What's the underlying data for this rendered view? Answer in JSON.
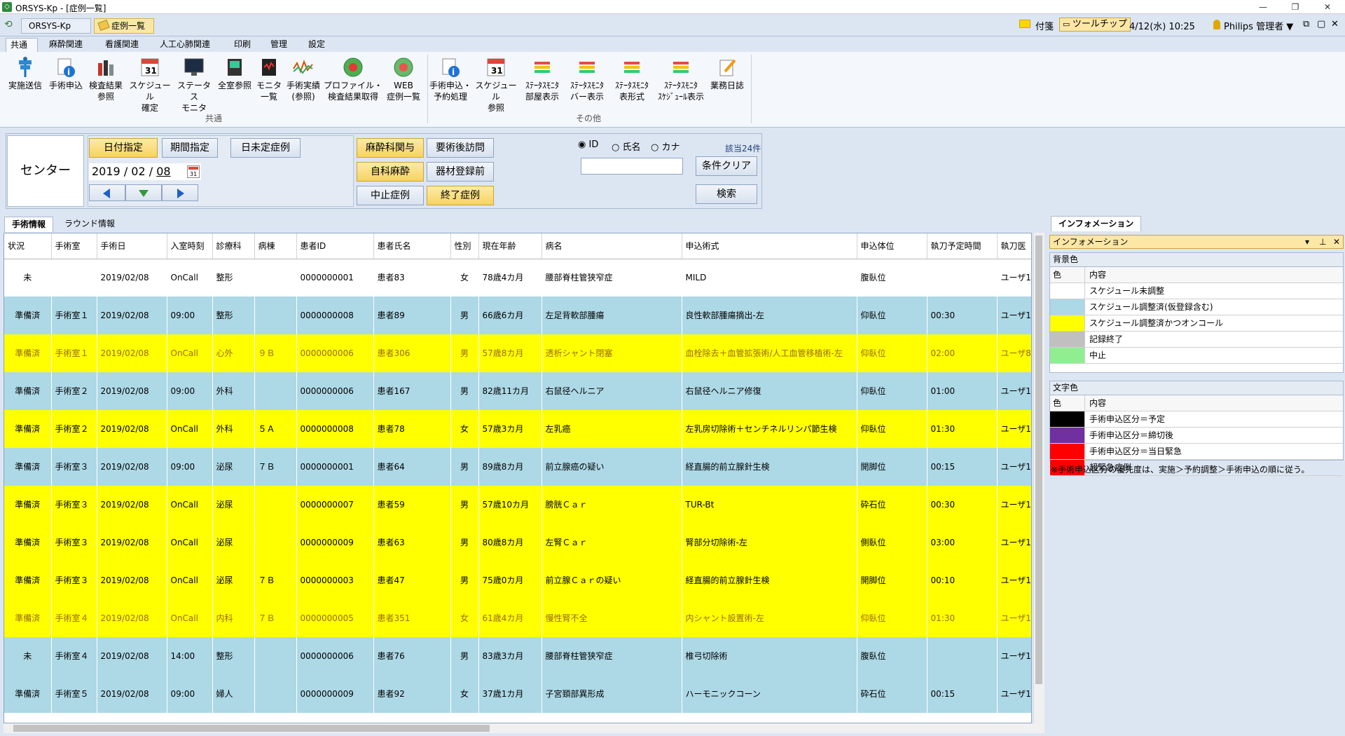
{
  "app": {
    "title": "ORSYS-Kp - [症例一覧]",
    "window_buttons": [
      "—",
      "❐",
      "✕"
    ]
  },
  "docbar": {
    "app_tab": "ORSYS-Kp",
    "active_tab": "症例一覧",
    "note_label": "付箋",
    "tooltip_label": "ツールチップ",
    "datetime": "4/12(水) 10:25",
    "user": "Philips 管理者 ▼",
    "win_controls": [
      "⧉",
      "▢",
      "✕"
    ]
  },
  "ribbon": {
    "tabs": [
      "共通",
      "麻酔関連",
      "看護関連",
      "人工心肺関連",
      "印刷",
      "管理",
      "設定"
    ],
    "group_common_label": "共通",
    "group_other_label": "その他",
    "buttons": [
      {
        "line1": "実施送信",
        "line2": "",
        "icon": "caduceus-icon"
      },
      {
        "line1": "手術申込",
        "line2": "",
        "icon": "info-doc-icon"
      },
      {
        "line1": "検査結果",
        "line2": "参照",
        "icon": "lab-result-icon"
      },
      {
        "line1": "スケジュール",
        "line2": "確定",
        "icon": "calendar-icon"
      },
      {
        "line1": "ステータス",
        "line2": "モニタ",
        "icon": "monitor-icon"
      },
      {
        "line1": "全室参照",
        "line2": "",
        "icon": "room-monitor-icon"
      },
      {
        "line1": "モニタ",
        "line2": "一覧",
        "icon": "monitor-list-icon"
      },
      {
        "line1": "手術実績",
        "line2": "(参照)",
        "icon": "vital-chart-icon"
      },
      {
        "line1": "プロファイル・",
        "line2": "検査結果取得",
        "icon": "globe-icon"
      },
      {
        "line1": "WEB",
        "line2": "症例一覧",
        "icon": "web-globe-icon"
      },
      {
        "line1": "手術申込・",
        "line2": "予約処理",
        "icon": "booking-icon"
      },
      {
        "line1": "スケジュール",
        "line2": "参照",
        "icon": "calendar-view-icon"
      },
      {
        "line1": "ｽﾃｰﾀｽﾓﾆﾀ",
        "line2": "部屋表示",
        "icon": "status-room-icon"
      },
      {
        "line1": "ｽﾃｰﾀｽﾓﾆﾀ",
        "line2": "バー表示",
        "icon": "status-bar-icon"
      },
      {
        "line1": "ｽﾃｰﾀｽﾓﾆﾀ",
        "line2": "表形式",
        "icon": "status-table-icon"
      },
      {
        "line1": "ｽﾃｰﾀｽﾓﾆﾀ",
        "line2": "ｽｹｼﾞｭｰﾙ表示",
        "icon": "status-schedule-icon"
      },
      {
        "line1": "業務日誌",
        "line2": "",
        "icon": "journal-icon"
      }
    ]
  },
  "filter": {
    "center_label": "センター",
    "date_mode_buttons": [
      "日付指定",
      "期間指定",
      "日未定症例"
    ],
    "date": {
      "year": "2019",
      "month": "02",
      "day": "08",
      "sep": "/"
    },
    "toggles": [
      "麻酔科関与",
      "要術後訪問",
      "自科麻酔",
      "器材登録前",
      "中止症例",
      "終了症例"
    ],
    "search_radios": [
      "ID",
      "氏名",
      "カナ"
    ],
    "search_value": "",
    "hit_count": "該当24件",
    "clear_button": "条件クリア",
    "search_button": "検索"
  },
  "content_tabs": [
    "手術情報",
    "ラウンド情報"
  ],
  "grid": {
    "columns": [
      "状況",
      "手術室",
      "手術日",
      "入室時刻",
      "診療科",
      "病棟",
      "患者ID",
      "患者氏名",
      "性別",
      "現在年齢",
      "病名",
      "申込術式",
      "申込体位",
      "執刀予定時間",
      "執刀医"
    ],
    "rows": [
      {
        "bg": "white",
        "brown": false,
        "cells": [
          "未",
          "",
          "2019/02/08",
          "OnCall",
          "整形",
          "",
          "0000000001",
          "患者83",
          "女",
          "78歳4カ月",
          "腰部脊柱管狭窄症",
          "MILD",
          "腹臥位",
          "",
          "ユーザ14"
        ]
      },
      {
        "bg": "blue",
        "brown": false,
        "cells": [
          "準備済",
          "手術室１",
          "2019/02/08",
          "09:00",
          "整形",
          "",
          "0000000008",
          "患者89",
          "男",
          "66歳6カ月",
          "左足背軟部腫瘍",
          "良性軟部腫瘍摘出-左",
          "仰臥位",
          "00:30",
          "ユーザ14"
        ]
      },
      {
        "bg": "yellow",
        "brown": true,
        "cells": [
          "準備済",
          "手術室１",
          "2019/02/08",
          "OnCall",
          "心外",
          "９Ｂ",
          "0000000006",
          "患者306",
          "男",
          "57歳8カ月",
          "透析シャント閉塞",
          "血栓除去＋血管拡張術/人工血管移植術-左",
          "仰臥位",
          "02:00",
          "ユーザ87"
        ]
      },
      {
        "bg": "blue",
        "brown": false,
        "cells": [
          "準備済",
          "手術室２",
          "2019/02/08",
          "09:00",
          "外科",
          "",
          "0000000006",
          "患者167",
          "男",
          "82歳11カ月",
          "右鼠径ヘルニア",
          "右鼠径ヘルニア修復",
          "仰臥位",
          "01:00",
          "ユーザ18"
        ]
      },
      {
        "bg": "yellow",
        "brown": false,
        "cells": [
          "準備済",
          "手術室２",
          "2019/02/08",
          "OnCall",
          "外科",
          "５Ａ",
          "0000000008",
          "患者78",
          "女",
          "57歳3カ月",
          "左乳癌",
          "左乳房切除術＋センチネルリンパ節生検",
          "仰臥位",
          "01:30",
          "ユーザ18"
        ]
      },
      {
        "bg": "blue",
        "brown": false,
        "cells": [
          "準備済",
          "手術室３",
          "2019/02/08",
          "09:00",
          "泌尿",
          "７Ｂ",
          "0000000001",
          "患者64",
          "男",
          "89歳8カ月",
          "前立腺癌の疑い",
          "経直腸的前立腺針生検",
          "開脚位",
          "00:15",
          "ユーザ18"
        ]
      },
      {
        "bg": "yellow",
        "brown": false,
        "cells": [
          "準備済",
          "手術室３",
          "2019/02/08",
          "OnCall",
          "泌尿",
          "",
          "0000000007",
          "患者59",
          "男",
          "57歳10カ月",
          "膀胱Ｃａｒ",
          "TUR-Bt",
          "砕石位",
          "00:30",
          "ユーザ18"
        ]
      },
      {
        "bg": "yellow",
        "brown": false,
        "cells": [
          "準備済",
          "手術室３",
          "2019/02/08",
          "OnCall",
          "泌尿",
          "",
          "0000000009",
          "患者63",
          "男",
          "80歳8カ月",
          "左腎Ｃａｒ",
          "腎部分切除術-左",
          "側臥位",
          "03:00",
          "ユーザ18"
        ]
      },
      {
        "bg": "yellow",
        "brown": false,
        "cells": [
          "準備済",
          "手術室３",
          "2019/02/08",
          "OnCall",
          "泌尿",
          "７Ｂ",
          "0000000003",
          "患者47",
          "男",
          "75歳0カ月",
          "前立腺Ｃａｒの疑い",
          "経直腸的前立腺針生検",
          "開脚位",
          "00:10",
          "ユーザ18"
        ]
      },
      {
        "bg": "yellow",
        "brown": true,
        "cells": [
          "準備済",
          "手術室４",
          "2019/02/08",
          "OnCall",
          "内科",
          "７Ｂ",
          "0000000005",
          "患者351",
          "女",
          "61歳4カ月",
          "慢性腎不全",
          "内シャント設置術-左",
          "仰臥位",
          "01:30",
          "ユーザ17"
        ]
      },
      {
        "bg": "blue",
        "brown": false,
        "cells": [
          "未",
          "手術室４",
          "2019/02/08",
          "14:00",
          "整形",
          "",
          "0000000006",
          "患者76",
          "男",
          "83歳3カ月",
          "腰部脊柱管狭窄症",
          "椎弓切除術",
          "腹臥位",
          "",
          "ユーザ15"
        ]
      },
      {
        "bg": "blue",
        "brown": false,
        "cells": [
          "準備済",
          "手術室５",
          "2019/02/08",
          "09:00",
          "婦人",
          "",
          "0000000009",
          "患者92",
          "女",
          "37歳1カ月",
          "子宮頚部異形成",
          "ハーモニックコーン",
          "砕石位",
          "00:15",
          "ユーザ10"
        ]
      }
    ]
  },
  "info": {
    "tab": "インフォメーション",
    "panel_title": "インフォメーション",
    "panel_controls": [
      "▾",
      "⊥",
      "✕"
    ],
    "bg_title": "背景色",
    "bg_head": [
      "色",
      "内容"
    ],
    "bg_items": [
      {
        "color": "#ffffff",
        "label": "スケジュール未調整"
      },
      {
        "color": "#add8e6",
        "label": "スケジュール調整済(仮登録含む)"
      },
      {
        "color": "#ffff00",
        "label": "スケジュール調整済かつオンコール"
      },
      {
        "color": "#c0c0c0",
        "label": "記録終了"
      },
      {
        "color": "#90ee90",
        "label": "中止"
      }
    ],
    "fg_title": "文字色",
    "fg_head": [
      "色",
      "内容"
    ],
    "fg_items": [
      {
        "color": "#000000",
        "label": "手術申込区分＝予定"
      },
      {
        "color": "#7030a0",
        "label": "手術申込区分＝締切後"
      },
      {
        "color": "#ff0000",
        "label": "手術申込区分＝当日緊急"
      },
      {
        "color": "#ff0000",
        "label": "超緊急症例"
      }
    ],
    "note": "※手術申込区分の優先度は、実施＞予約調整＞手術申込の順に従う。"
  }
}
